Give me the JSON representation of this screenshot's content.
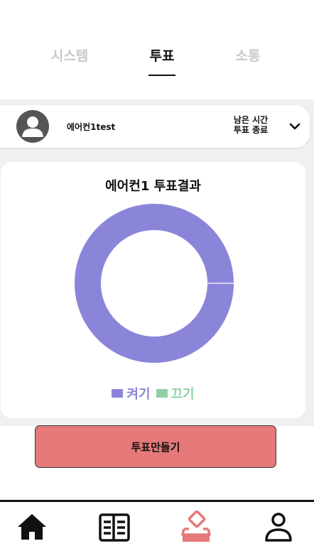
{
  "tabs": {
    "system": "시스템",
    "vote": "투표",
    "talk": "소통"
  },
  "vote_selector": {
    "name": "에어컨1test",
    "remain_line1": "남은 시간",
    "remain_line2": "투표 종료"
  },
  "result": {
    "title": "에어컨1 투표결과"
  },
  "chart_data": {
    "type": "pie",
    "categories": [
      "켜기",
      "끄기"
    ],
    "values": [
      100,
      0
    ],
    "colors": [
      "#8b85da",
      "#8fd1a4"
    ],
    "legend_position": "bottom"
  },
  "buttons": {
    "create_vote": "투표만들기"
  },
  "bottom_nav": {
    "items": [
      "home-icon",
      "board-icon",
      "vote-icon",
      "user-icon"
    ],
    "active_color": "#e57878"
  }
}
